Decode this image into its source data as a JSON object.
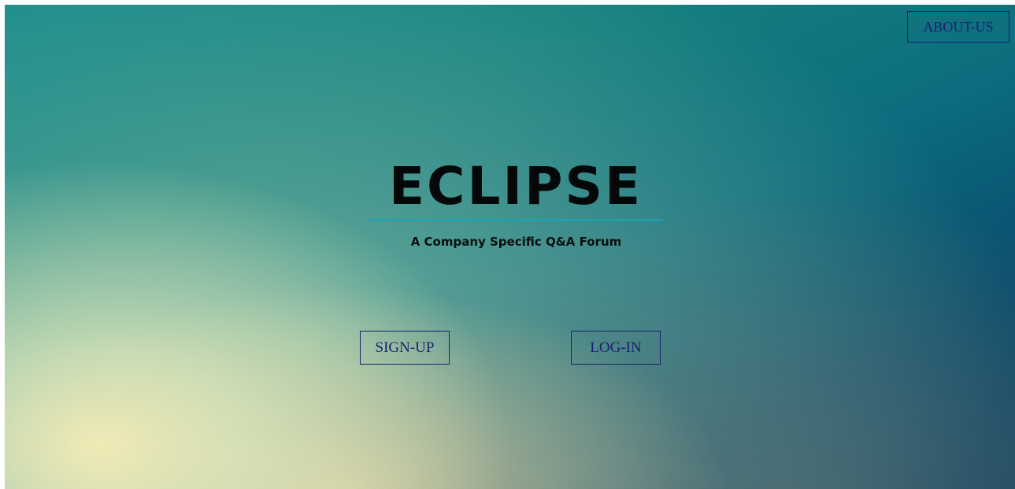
{
  "header": {
    "about_label": "ABOUT-US"
  },
  "hero": {
    "brand": "ECLIPSE",
    "tagline": "A Company Specific Q&A Forum"
  },
  "actions": {
    "signup_label": "SIGN-UP",
    "login_label": "LOG-IN"
  },
  "colors": {
    "accent_underline": "#15a7b6",
    "button_text": "#1c1f6e",
    "background_top_right": "#043a5e",
    "background_bottom_left": "#f7eeb7"
  }
}
